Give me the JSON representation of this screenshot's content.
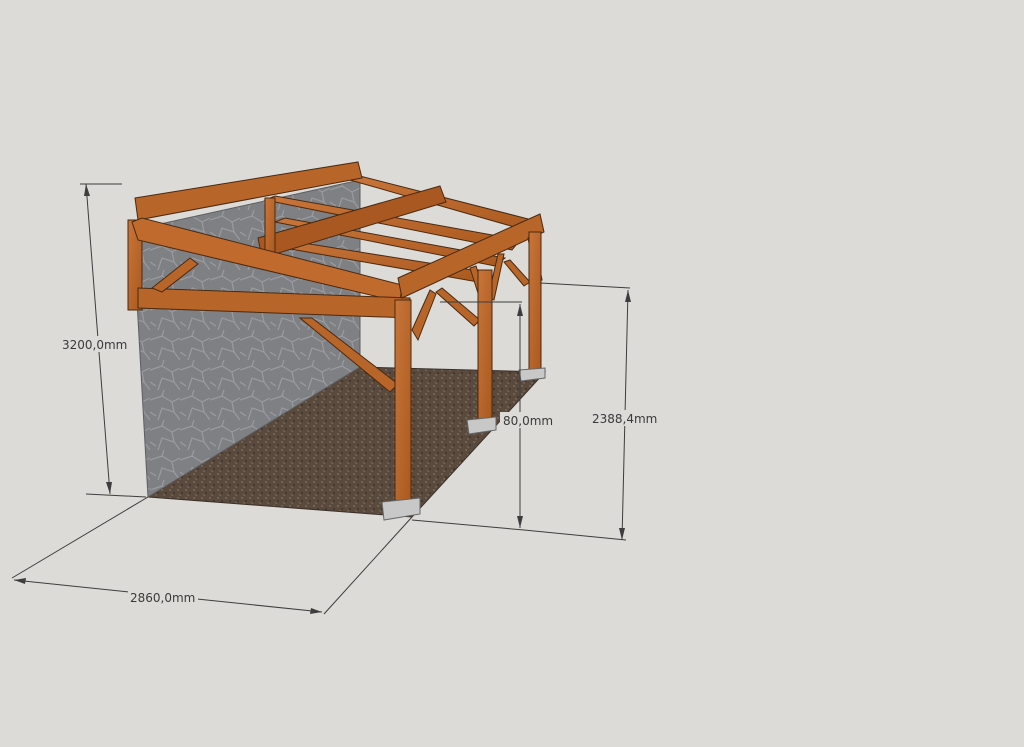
{
  "dimensions": {
    "height_left": "3200,0mm",
    "width_bottom": "2860,0mm",
    "height_right": "2388,4mm",
    "height_inner": "80,0mm"
  },
  "colors": {
    "background": "#dcdbd7",
    "timber": "#b8652a",
    "timber_dark": "#8a4515",
    "wall": "#7f8084",
    "ground": "#5a4a3e",
    "footing": "#c8c8c8"
  }
}
